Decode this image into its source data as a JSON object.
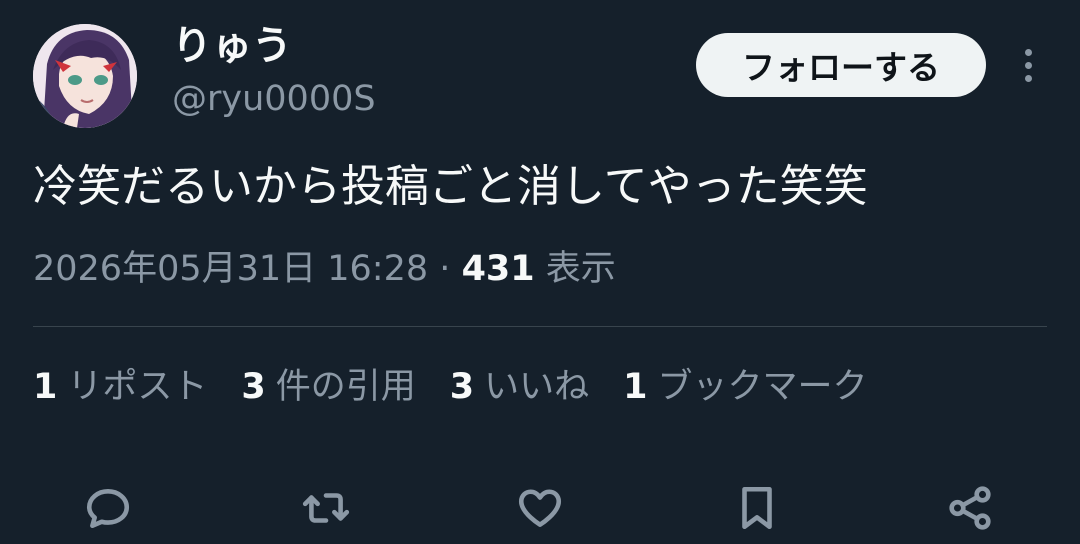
{
  "user": {
    "display_name": "りゅう",
    "handle": "@ryu0000S",
    "avatar_icon": "anime-character-avatar"
  },
  "header": {
    "follow_label": "フォローする",
    "more_icon": "more-vertical-icon"
  },
  "tweet": {
    "text": "冷笑だるいから投稿ごと消してやった笑笑",
    "timestamp": "2026年05月31日 16:28",
    "separator": "·",
    "views_count": "431",
    "views_label": "表示"
  },
  "stats": [
    {
      "count": "1",
      "label": "リポスト"
    },
    {
      "count": "3",
      "label": "件の引用"
    },
    {
      "count": "3",
      "label": "いいね"
    },
    {
      "count": "1",
      "label": "ブックマーク"
    }
  ],
  "actions": [
    {
      "icon": "reply-icon"
    },
    {
      "icon": "retweet-icon"
    },
    {
      "icon": "like-icon"
    },
    {
      "icon": "bookmark-icon"
    },
    {
      "icon": "share-icon"
    }
  ],
  "colors": {
    "background": "#15202b",
    "primary_text": "#f7f9f9",
    "secondary_text": "#8b98a5",
    "divider": "#38444d",
    "button_bg": "#eff3f4",
    "button_text": "#0f1419"
  }
}
